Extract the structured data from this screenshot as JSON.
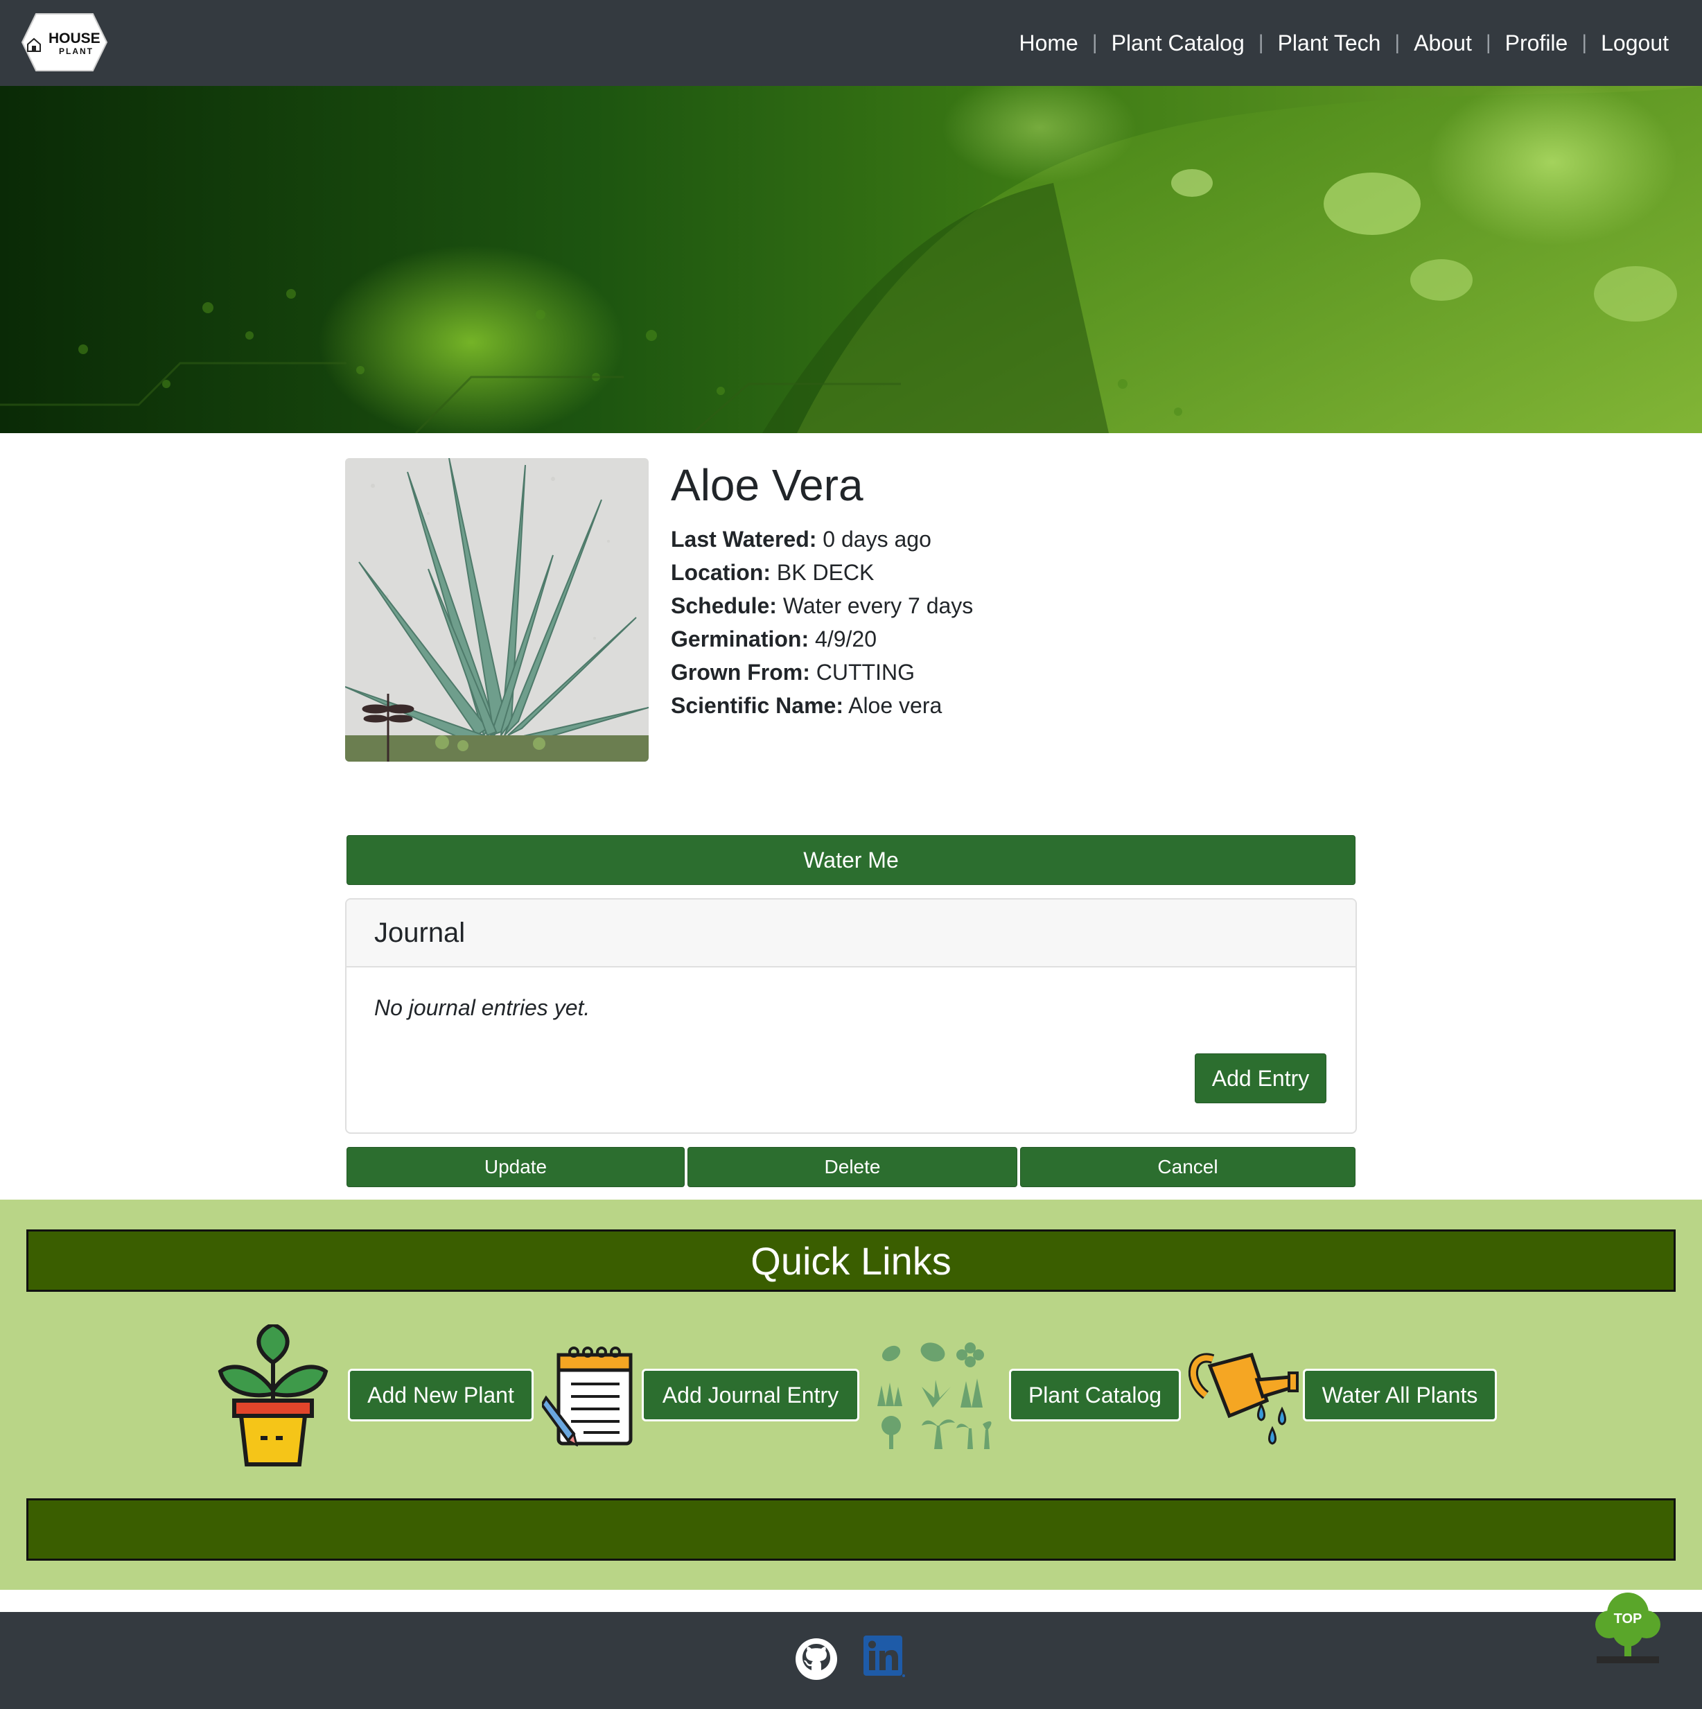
{
  "nav": {
    "logo_line1": "HOUSE",
    "logo_line2": "PLANT",
    "links": [
      "Home",
      "Plant Catalog",
      "Plant Tech",
      "About",
      "Profile",
      "Logout"
    ],
    "separator": "|"
  },
  "plant": {
    "name": "Aloe Vera",
    "fields": [
      {
        "label": "Last Watered:",
        "value": "0 days ago"
      },
      {
        "label": "Location:",
        "value": "BK DECK"
      },
      {
        "label": "Schedule:",
        "value": "Water every 7 days"
      },
      {
        "label": "Germination:",
        "value": "4/9/20"
      },
      {
        "label": "Grown From:",
        "value": "CUTTING"
      },
      {
        "label": "Scientific Name:",
        "value": "Aloe vera"
      }
    ]
  },
  "water_button": "Water Me",
  "journal": {
    "title": "Journal",
    "empty_text": "No journal entries yet.",
    "add_entry": "Add Entry"
  },
  "actions": {
    "update": "Update",
    "delete": "Delete",
    "cancel": "Cancel"
  },
  "quick_links": {
    "title": "Quick Links",
    "buttons": [
      "Add New Plant",
      "Add Journal Entry",
      "Plant Catalog",
      "Water All Plants"
    ]
  },
  "top_button": "TOP",
  "colors": {
    "navbar": "#343a40",
    "button_green": "#2c6e2f",
    "quick_bg": "#b9d587",
    "quick_bar": "#3a5e00"
  },
  "icons": [
    "house-plant-logo",
    "potted-plant-icon",
    "notepad-pencil-icon",
    "plant-catalog-icon",
    "watering-can-icon",
    "github-icon",
    "linkedin-icon",
    "tree-top-icon"
  ]
}
